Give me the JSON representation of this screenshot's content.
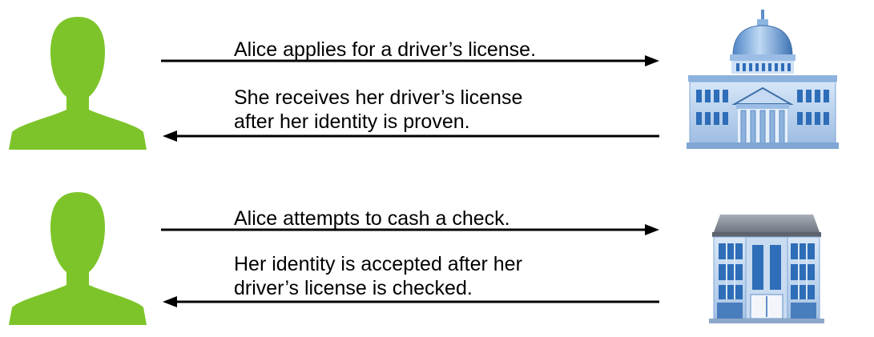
{
  "rows": [
    {
      "actor": "person-icon",
      "institution": "government-building-icon",
      "request_text": "Alice applies for a driver’s license.",
      "response_lines": [
        "She receives her driver’s license",
        "after her identity is proven."
      ]
    },
    {
      "actor": "person-icon",
      "institution": "bank-building-icon",
      "request_text": "Alice attempts to cash a check.",
      "response_lines": [
        "Her identity is accepted after her",
        "driver’s license is checked."
      ]
    }
  ],
  "colors": {
    "person": "#7DC42A",
    "arrow": "#000000",
    "building_light": "#B9D3F0",
    "building_dark": "#5E8FC8",
    "window": "#2E6DB8"
  }
}
